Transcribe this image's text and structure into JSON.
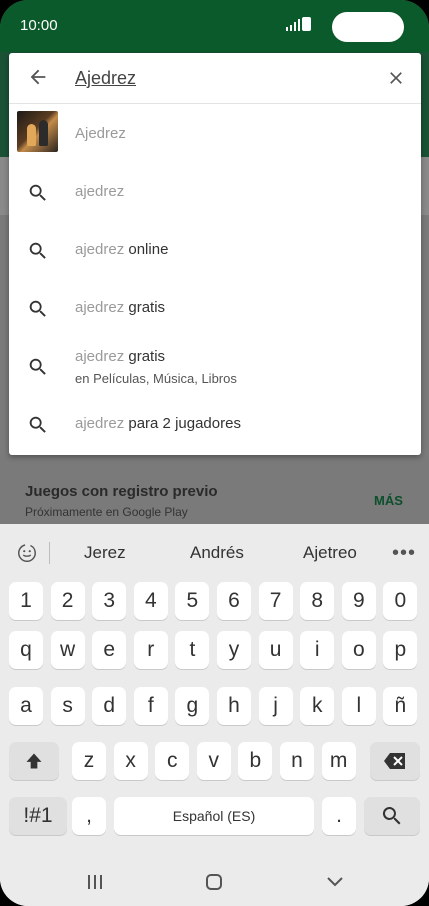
{
  "status": {
    "time": "10:00"
  },
  "background": {
    "section_title": "Juegos con registro previo",
    "section_subtitle": "Próximamente en Google Play",
    "more_label": "MÁS"
  },
  "search": {
    "query": "Ajedrez",
    "suggestions": [
      {
        "typed": "Ajedrez",
        "rest": "",
        "sub": ""
      },
      {
        "typed": "ajedrez",
        "rest": "",
        "sub": ""
      },
      {
        "typed": "ajedrez",
        "rest": " online",
        "sub": ""
      },
      {
        "typed": "ajedrez",
        "rest": " gratis",
        "sub": ""
      },
      {
        "typed": "ajedrez",
        "rest": " gratis",
        "sub": "en Películas, Música, Libros"
      },
      {
        "typed": "ajedrez",
        "rest": " para 2 jugadores",
        "sub": ""
      }
    ]
  },
  "keyboard": {
    "predictions": [
      "Jerez",
      "Andrés",
      "Ajetreo"
    ],
    "more": "•••",
    "row_numbers": [
      "1",
      "2",
      "3",
      "4",
      "5",
      "6",
      "7",
      "8",
      "9",
      "0"
    ],
    "row1": [
      "q",
      "w",
      "e",
      "r",
      "t",
      "y",
      "u",
      "i",
      "o",
      "p"
    ],
    "row2": [
      "a",
      "s",
      "d",
      "f",
      "g",
      "h",
      "j",
      "k",
      "l",
      "ñ"
    ],
    "row3": [
      "z",
      "x",
      "c",
      "v",
      "b",
      "n",
      "m"
    ],
    "symbols_label": "!#1",
    "comma_label": ",",
    "space_label": "Español (ES)",
    "period_label": "."
  },
  "icons": {
    "back": "arrow-left-icon",
    "close": "close-icon",
    "search": "search-icon",
    "shift": "shift-icon",
    "backspace": "backspace-icon",
    "emoji": "emoji-icon"
  },
  "colors": {
    "brand_green": "#0b5a2b",
    "accent_green": "#0b4f2b"
  }
}
